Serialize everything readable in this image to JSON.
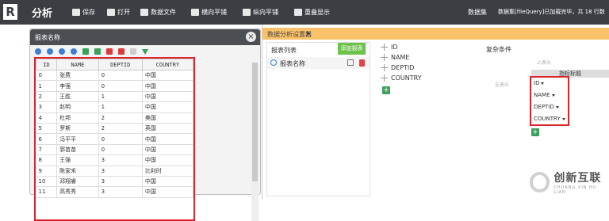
{
  "topbar": {
    "logo": "R",
    "title": "分析",
    "tools": [
      {
        "label": "保存",
        "icon": "save-icon"
      },
      {
        "label": "打开",
        "icon": "folder-open-icon"
      },
      {
        "label": "数据文件",
        "icon": "folder-icon"
      },
      {
        "label": "横向平铺",
        "icon": "tile-horizontal-icon"
      },
      {
        "label": "纵向平铺",
        "icon": "tile-vertical-icon"
      },
      {
        "label": "重叠显示",
        "icon": "cascade-icon"
      }
    ],
    "dataset": "数据集",
    "message": "数据集[fileQuery]已加载完毕，共 18 行数"
  },
  "dialog": {
    "title": "报表名称",
    "close": "×",
    "columns": [
      "ID",
      "NAME",
      "DEPTID",
      "COUNTRY"
    ],
    "rows": [
      [
        "0",
        "张费",
        "0",
        "中国"
      ],
      [
        "1",
        "李强",
        "0",
        "中国"
      ],
      [
        "2",
        "王胜",
        "1",
        "中国"
      ],
      [
        "3",
        "赵明",
        "1",
        "中国"
      ],
      [
        "4",
        "杜邦",
        "2",
        "美国"
      ],
      [
        "5",
        "罗斯",
        "2",
        "英国"
      ],
      [
        "6",
        "冯平平",
        "0",
        "中国"
      ],
      [
        "7",
        "郭苗苗",
        "0",
        "中国"
      ],
      [
        "8",
        "王强",
        "3",
        "中国"
      ],
      [
        "9",
        "陈家禾",
        "3",
        "比利时"
      ],
      [
        "10",
        "邓翔睿",
        "3",
        "中国"
      ],
      [
        "11",
        "高秀秀",
        "3",
        "中国"
      ]
    ]
  },
  "settings": {
    "title": "数据分析设置器",
    "list_label": "报表列表",
    "add_button": "添加报表",
    "report_item": "报表名称",
    "fields": [
      "ID",
      "NAME",
      "DEPTID",
      "COUNTRY"
    ],
    "plus": "+",
    "cond_label": "复杂条件",
    "top_hint": "上表头",
    "left_hint": "左表头",
    "metric_header": "指标标题",
    "dims": [
      "ID",
      "NAME",
      "DEPTID",
      "COUNTRY"
    ]
  },
  "watermark": {
    "brand": "创新互联",
    "sub": "CHUANG XIN HU LIAN"
  }
}
